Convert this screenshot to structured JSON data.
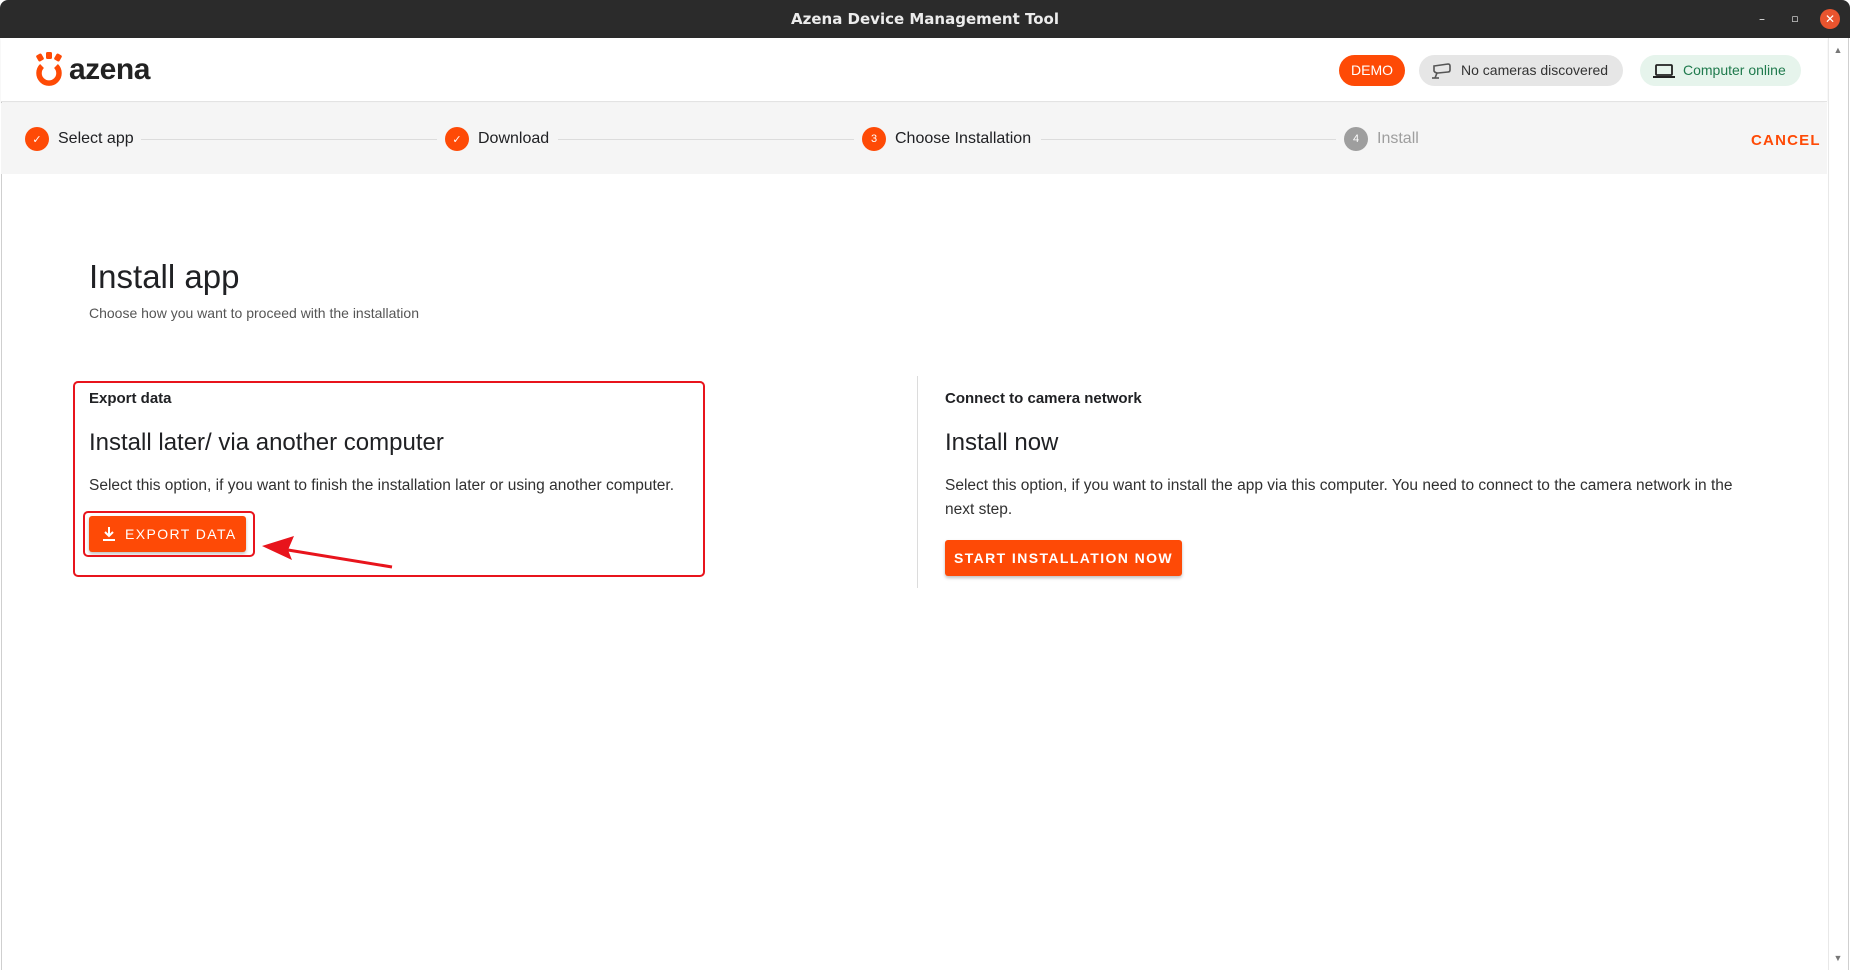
{
  "window": {
    "title": "Azena Device Management Tool",
    "min_glyph": "–",
    "max_glyph": "▫",
    "close_glyph": "✕"
  },
  "header": {
    "logo_text": "azena",
    "demo_badge": "DEMO",
    "cameras_status": "No cameras discovered",
    "computer_status": "Computer online",
    "brand_color": "#fe4a06"
  },
  "stepper": {
    "steps": [
      {
        "label": "Select app",
        "state": "done",
        "marker": "✓"
      },
      {
        "label": "Download",
        "state": "done",
        "marker": "✓"
      },
      {
        "label": "Choose Installation",
        "state": "active",
        "marker": "3"
      },
      {
        "label": "Install",
        "state": "pending",
        "marker": "4"
      }
    ],
    "cancel_label": "CANCEL"
  },
  "page": {
    "title": "Install app",
    "subtitle": "Choose how you want to proceed with the installation"
  },
  "options": {
    "export": {
      "eyebrow": "Export data",
      "headline": "Install later/ via another computer",
      "description": "Select this option, if you want to finish the installation later or using another computer.",
      "button_label": "EXPORT DATA"
    },
    "install": {
      "eyebrow": "Connect to camera network",
      "headline": "Install now",
      "description": "Select this option, if you want to install the app via this computer. You need to connect to the camera network in the next step.",
      "button_label": "START INSTALLATION NOW"
    }
  },
  "icons": {
    "logo": "azena-logo-icon",
    "camera": "camera-icon",
    "laptop": "laptop-icon",
    "download": "download-icon"
  },
  "annotation_color": "#e8141c"
}
